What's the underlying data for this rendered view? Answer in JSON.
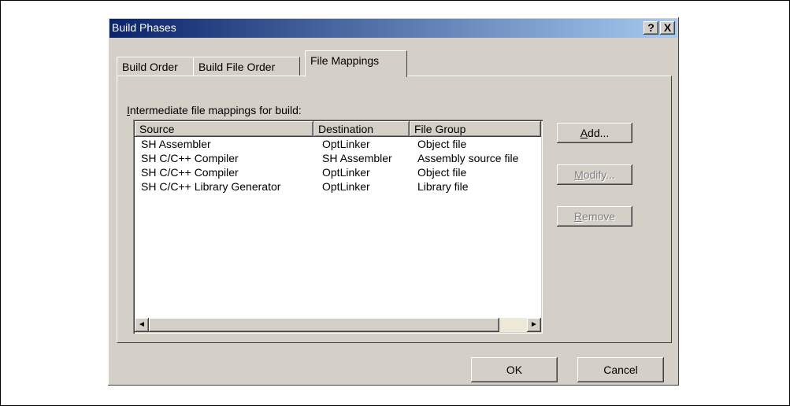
{
  "dialog": {
    "title": "Build Phases",
    "help_label": "?",
    "close_label": "X"
  },
  "tabs": [
    {
      "label": "Build Order"
    },
    {
      "label": "Build File Order"
    },
    {
      "label": "File Mappings",
      "active": true
    }
  ],
  "panel": {
    "label_mnemonic": "I",
    "label_rest": "ntermediate file mappings for build:"
  },
  "table": {
    "columns": [
      "Source",
      "Destination",
      "File Group"
    ],
    "rows": [
      [
        "SH Assembler",
        "OptLinker",
        "Object file"
      ],
      [
        "SH C/C++ Compiler",
        "SH Assembler",
        "Assembly source file"
      ],
      [
        "SH C/C++ Compiler",
        "OptLinker",
        "Object file"
      ],
      [
        "SH C/C++ Library Generator",
        "OptLinker",
        "Library file"
      ]
    ]
  },
  "scrollbar": {
    "left_arrow": "◄",
    "right_arrow": "►"
  },
  "buttons": {
    "add_mnemonic": "A",
    "add_rest": "dd...",
    "modify_mnemonic": "M",
    "modify_rest": "odify...",
    "remove_mnemonic": "R",
    "remove_rest": "emove",
    "ok": "OK",
    "cancel": "Cancel"
  }
}
